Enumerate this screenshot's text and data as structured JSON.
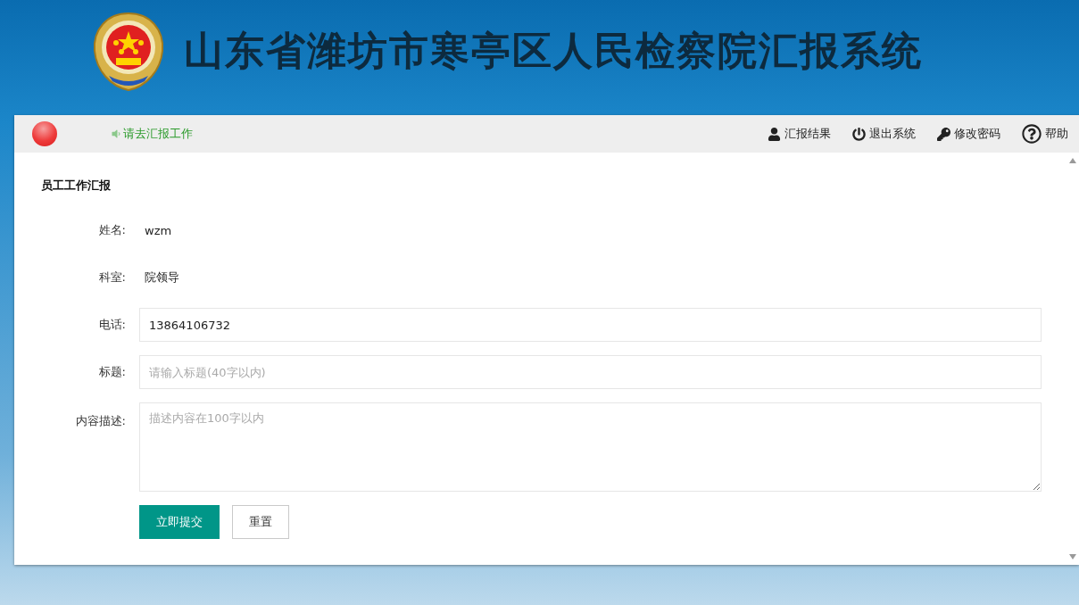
{
  "header": {
    "title": "山东省潍坊市寒亭区人民检察院汇报系统"
  },
  "toolbar": {
    "notice": "请去汇报工作",
    "menu": [
      {
        "kind": "user",
        "label": "汇报结果"
      },
      {
        "kind": "power",
        "label": "退出系统"
      },
      {
        "kind": "key",
        "label": "修改密码"
      },
      {
        "kind": "help",
        "label": "帮助"
      }
    ]
  },
  "form": {
    "heading": "员工工作汇报",
    "fields": [
      {
        "kind": "text",
        "label": "姓名:",
        "value": "wzm"
      },
      {
        "kind": "text",
        "label": "科室:",
        "value": "院领导"
      },
      {
        "kind": "input",
        "label": "电话:",
        "value": "13864106732"
      },
      {
        "kind": "input",
        "label": "标题:",
        "placeholder": "请输入标题(40字以内)"
      },
      {
        "kind": "textarea",
        "label": "内容描述:",
        "placeholder": "描述内容在100字以内"
      }
    ],
    "buttons": [
      {
        "kind": "primary",
        "label": "立即提交"
      },
      {
        "kind": "plain",
        "label": "重置"
      }
    ]
  }
}
